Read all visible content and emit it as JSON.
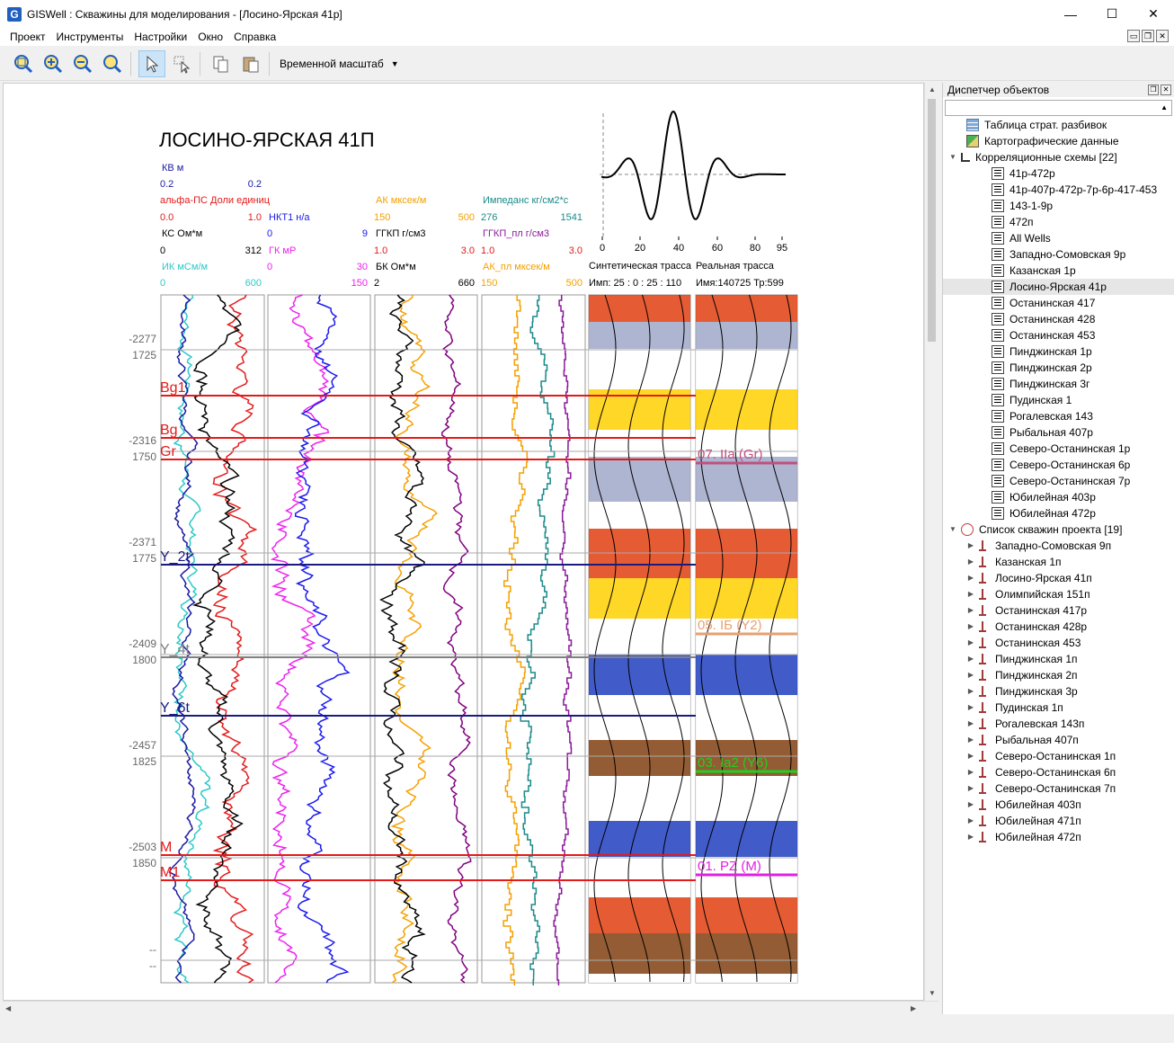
{
  "window": {
    "title": "GISWell : Скважины для моделирования - [Лосино-Ярская 41р]",
    "app_icon": "G",
    "minimize": "—",
    "maximize": "☐",
    "close": "✕"
  },
  "menu": [
    "Проект",
    "Инструменты",
    "Настройки",
    "Окно",
    "Справка"
  ],
  "toolbar": {
    "scale_label": "Временной масштаб",
    "icons": [
      "zoom-fit-icon",
      "zoom-in-icon",
      "zoom-out-icon",
      "zoom-reset-icon",
      "pointer-icon",
      "select-tool-icon",
      "copy-icon",
      "paste-icon"
    ]
  },
  "panel": {
    "title": "Диспетчер объектов",
    "strat_table": "Таблица страт. разбивок",
    "carto": "Картографические данные",
    "corr_header": "Корреляционные схемы [22]",
    "corr_items": [
      "41р-472р",
      "41р-407р-472р-7р-6р-417-453",
      "143-1-9р",
      "472п",
      "All Wells",
      "Западно-Сомовская 9р",
      "Казанская 1р",
      "Лосино-Ярская 41р",
      "Останинская 417",
      "Останинская 428",
      "Останинская 453",
      "Пинджинская 1р",
      "Пинджинская 2р",
      "Пинджинская 3г",
      "Пудинская 1",
      "Рогалевская 143",
      "Рыбальная 407р",
      "Северо-Останинская 1р",
      "Северо-Останинская 6р",
      "Северо-Останинская 7р",
      "Юбилейная 403р",
      "Юбилейная 472р"
    ],
    "selected_item": "Лосино-Ярская 41р",
    "wells_header": "Список скважин проекта [19]",
    "wells": [
      "Западно-Сомовская 9п",
      "Казанская 1п",
      "Лосино-Ярская 41п",
      "Олимпийская 151п",
      "Останинская 417р",
      "Останинская 428р",
      "Останинская 453",
      "Пинджинская 1п",
      "Пинджинская 2п",
      "Пинджинская 3р",
      "Пудинская 1п",
      "Рогалевская 143п",
      "Рыбальная 407п",
      "Северо-Останинская 1п",
      "Северо-Останинская 6п",
      "Северо-Останинская 7п",
      "Юбилейная 403п",
      "Юбилейная 471п",
      "Юбилейная 472п"
    ]
  },
  "log": {
    "well_title": "ЛОСИНО-ЯРСКАЯ 41П",
    "headers": {
      "kv": {
        "name": "КВ м",
        "min": "0.2",
        "max": "0.2",
        "color": "#1a1aa0"
      },
      "alpha": {
        "name": "альфа-ПС Доли единиц",
        "min": "0.0",
        "max": "1.0",
        "color": "#e31a1a"
      },
      "ks": {
        "name": "КС Ом*м",
        "min": "0",
        "max": "312",
        "color": "#000000"
      },
      "ik": {
        "name": "ИК мСм/м",
        "min": "0",
        "max": "600",
        "color": "#2ec8c8"
      },
      "nkt": {
        "name": "НКТ1 н/а",
        "min": "0",
        "max": "9",
        "color": "#1a1aee"
      },
      "gk": {
        "name": "ГК мР",
        "min": "0",
        "max": "30",
        "color": "#ee22ee"
      },
      "gk_r": {
        "name": "",
        "min": "",
        "max": "150",
        "color": "#ee22ee"
      },
      "ak": {
        "name": "АК мксек/м",
        "min": "150",
        "max": "500",
        "color": "#f5a000"
      },
      "ggkp": {
        "name": "ГГКП г/см3",
        "min": "1.0",
        "max": "3.0",
        "color": "#000000"
      },
      "bk": {
        "name": "БК Ом*м",
        "min": "2",
        "max": "660",
        "color": "#000000"
      },
      "imp": {
        "name": "Импеданс кг/см2*с",
        "min": "276",
        "max": "1541",
        "color": "#1a8a8a"
      },
      "ggkp_pl": {
        "name": "ГГКП_пл г/см3",
        "min": "1.0",
        "max": "3.0",
        "color": "#8a1a9a"
      },
      "ak_pl": {
        "name": "АК_пл мксек/м",
        "min": "150",
        "max": "500",
        "color": "#f5a000"
      }
    },
    "synthetic_label": "Синтетическая трасса",
    "real_label": "Реальная трасса",
    "synthetic_params": "Имп: 25 : 0 : 25 : 110",
    "real_params": "Имя:140725 Тр:599",
    "wavelet_ticks": [
      "0",
      "20",
      "40",
      "60",
      "80",
      "95"
    ],
    "depth_marks": [
      {
        "a": "-2277",
        "b": "1725"
      },
      {
        "a": "-2316",
        "b": "1750"
      },
      {
        "a": "-2371",
        "b": "1775"
      },
      {
        "a": "-2409",
        "b": "1800"
      },
      {
        "a": "-2457",
        "b": "1825"
      },
      {
        "a": "-2503",
        "b": "1850"
      },
      {
        "a": "--",
        "b": "--"
      }
    ],
    "horizons": [
      "Bg1",
      "Bg",
      "Gr",
      "Y_2t",
      "Y_4t",
      "Y_6t",
      "M",
      "M1"
    ],
    "horizon_colors": {
      "Bg1": "#e31a1a",
      "Bg": "#e31a1a",
      "Gr": "#e31a1a",
      "Y_2t": "#1a1a80",
      "Y_4t": "#808080",
      "Y_6t": "#1a1a80",
      "M": "#e31a1a",
      "M1": "#e31a1a"
    },
    "reflectors": [
      {
        "label": "07. IIa (Gr)",
        "color": "#c05080"
      },
      {
        "label": "05. IБ (Y2)",
        "color": "#e8a070"
      },
      {
        "label": "03. Ia2 (Y6)",
        "color": "#20d020"
      },
      {
        "label": "01. PZ (M)",
        "color": "#e020e0"
      }
    ]
  }
}
